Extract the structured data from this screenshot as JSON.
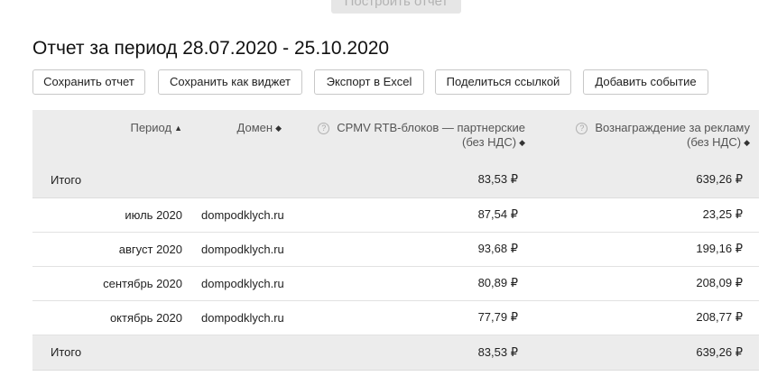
{
  "top_button": {
    "label": "Построить отчет"
  },
  "page": {
    "title": "Отчет за период 28.07.2020 - 25.10.2020"
  },
  "toolbar": {
    "buttons": [
      {
        "label": "Сохранить отчет"
      },
      {
        "label": "Сохранить как виджет"
      },
      {
        "label": "Экспорт в Excel"
      },
      {
        "label": "Поделиться ссылкой"
      },
      {
        "label": "Добавить событие"
      }
    ]
  },
  "icons": {
    "sort_asc": "triangle-up-icon",
    "sort_both": "sort-arrows-icon",
    "help": "question-circle-icon"
  },
  "table": {
    "columns": [
      {
        "label": "Период",
        "sort_glyph": "▲"
      },
      {
        "label": "Домен",
        "sort_glyph": "◆"
      },
      {
        "label_line1": "CPMV RTB-блоков — партнерские",
        "label_line2": "(без НДС)",
        "sort_glyph": "◆",
        "help_glyph": "?"
      },
      {
        "label_line1": "Вознаграждение за рекламу",
        "label_line2": "(без НДС)",
        "sort_glyph": "◆",
        "help_glyph": "?"
      }
    ],
    "total_top": {
      "label": "Итого",
      "cpmv": "83,53 ₽",
      "reward": "639,26 ₽"
    },
    "rows": [
      {
        "period": "июль 2020",
        "domain": "dompodklych.ru",
        "cpmv": "87,54 ₽",
        "reward": "23,25 ₽"
      },
      {
        "period": "август 2020",
        "domain": "dompodklych.ru",
        "cpmv": "93,68 ₽",
        "reward": "199,16 ₽"
      },
      {
        "period": "сентябрь 2020",
        "domain": "dompodklych.ru",
        "cpmv": "80,89 ₽",
        "reward": "208,09 ₽"
      },
      {
        "period": "октябрь 2020",
        "domain": "dompodklych.ru",
        "cpmv": "77,79 ₽",
        "reward": "208,77 ₽"
      }
    ],
    "total_bottom": {
      "label": "Итого",
      "cpmv": "83,53 ₽",
      "reward": "639,26 ₽"
    }
  }
}
